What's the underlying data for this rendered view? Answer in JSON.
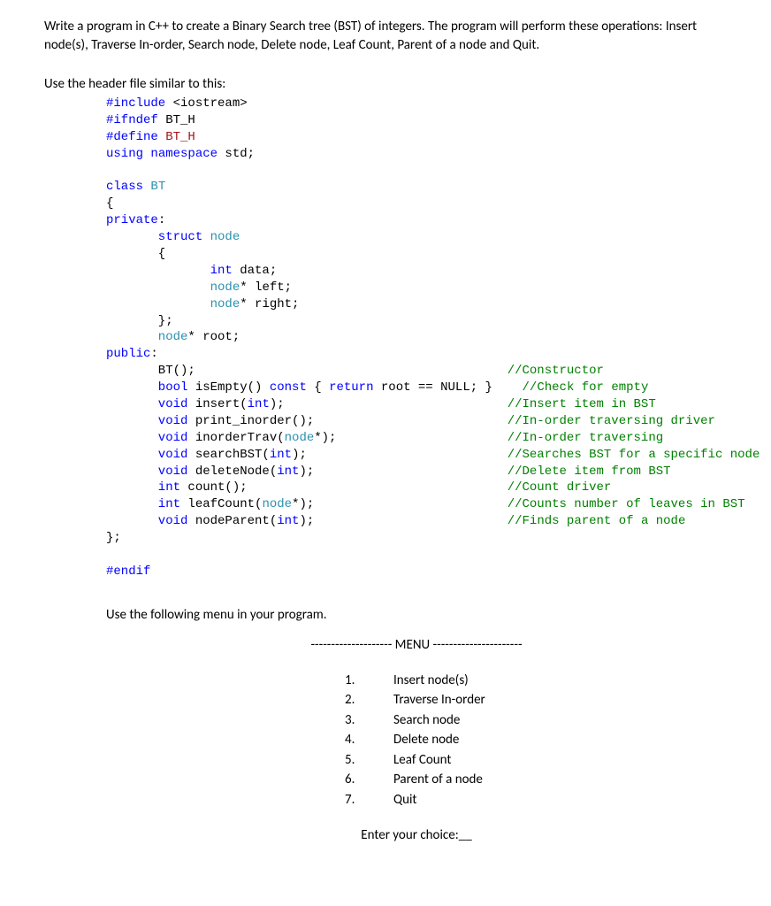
{
  "intro": "Write a program in C++ to create a Binary Search tree (BST) of integers. The program will perform these operations: Insert node(s), Traverse In-order, Search node, Delete node, Leaf Count, Parent of a node and Quit.",
  "header_hint": "Use the header file similar to this:",
  "code": {
    "l1a": "#include",
    "l1b": " <iostream>",
    "l2a": "#ifndef",
    "l2b": " BT_H",
    "l3a": "#define",
    "l3b": " BT_H",
    "l4a": "using",
    "l4b": " namespace",
    "l4c": " std;",
    "l5a": "class",
    "l5b": " BT",
    "l6": "{",
    "l7a": "private",
    "l7b": ":",
    "l8a": "       struct",
    "l8b": " node",
    "l9": "       {",
    "l10a": "              int",
    "l10b": " data;",
    "l11a": "              node",
    "l11b": "* left;",
    "l12a": "              node",
    "l12b": "* right;",
    "l13": "       };",
    "l14a": "       node",
    "l14b": "* root;",
    "l15a": "public",
    "l15b": ":",
    "l16a": "       BT();                                          ",
    "l16c": "//Constructor",
    "l17a": "       bool",
    "l17b": " isEmpty() ",
    "l17c": "const",
    "l17d": " { ",
    "l17e": "return",
    "l17f": " root == NULL; }    ",
    "l17g": "//Check for empty",
    "l18a": "       void",
    "l18b": " insert(",
    "l18c": "int",
    "l18d": ");                              ",
    "l18e": "//Insert item in BST",
    "l19a": "       void",
    "l19b": " print_inorder();                          ",
    "l19c": "//In-order traversing driver",
    "l20a": "       void",
    "l20b": " inorderTrav(",
    "l20c": "node",
    "l20d": "*);                       ",
    "l20e": "//In-order traversing",
    "l21a": "       void",
    "l21b": " searchBST(",
    "l21c": "int",
    "l21d": ");                           ",
    "l21e": "//Searches BST for a specific node",
    "l22a": "       void",
    "l22b": " deleteNode(",
    "l22c": "int",
    "l22d": ");                          ",
    "l22e": "//Delete item from BST",
    "l23a": "       int",
    "l23b": " count();                                   ",
    "l23c": "//Count driver",
    "l24a": "       int",
    "l24b": " leafCount(",
    "l24c": "node",
    "l24d": "*);                          ",
    "l24e": "//Counts number of leaves in BST",
    "l25a": "       void",
    "l25b": " nodeParent(",
    "l25c": "int",
    "l25d": ");                          ",
    "l25e": "//Finds parent of a node",
    "l26": "};",
    "l27": "#endif"
  },
  "use_menu": "Use the following menu in your program.",
  "menu_title": "-------------------- MENU ----------------------",
  "menu_items": [
    {
      "n": "1.",
      "label": "Insert node(s)"
    },
    {
      "n": "2.",
      "label": "Traverse In-order"
    },
    {
      "n": "3.",
      "label": "Search node"
    },
    {
      "n": "4.",
      "label": "Delete node"
    },
    {
      "n": "5.",
      "label": "Leaf Count"
    },
    {
      "n": "6.",
      "label": "Parent of a node"
    },
    {
      "n": "7.",
      "label": "Quit"
    }
  ],
  "choice": "Enter your choice:__"
}
